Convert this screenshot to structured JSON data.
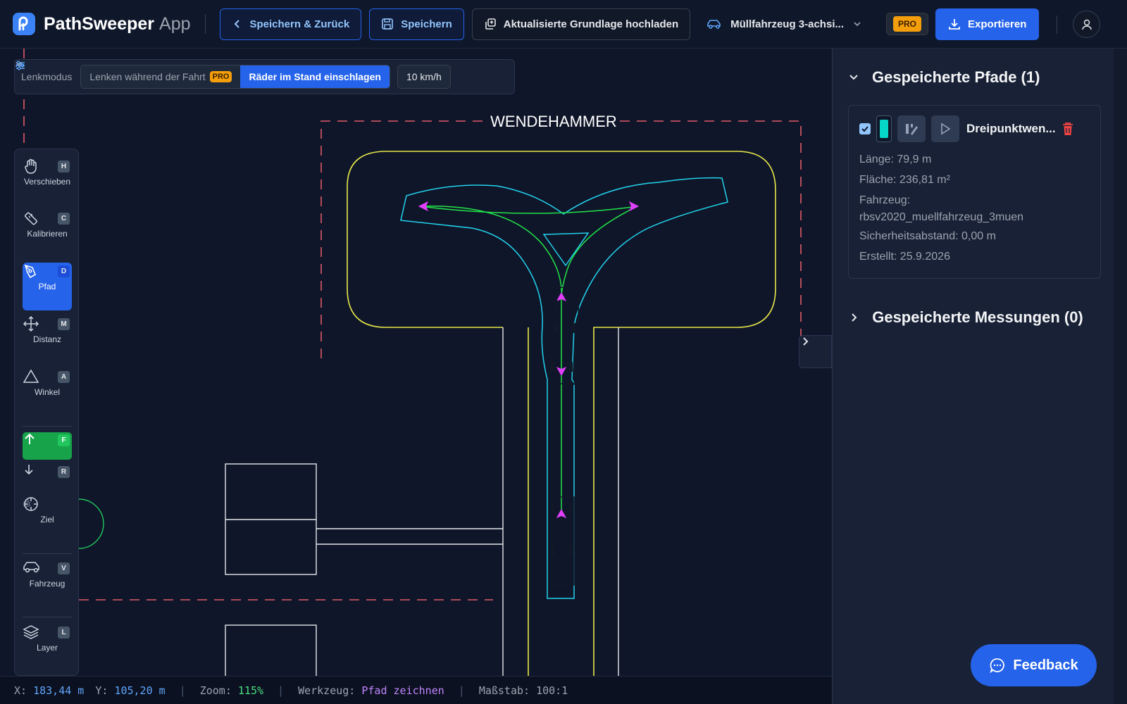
{
  "header": {
    "app_name": "PathSweeper",
    "app_suffix": "App",
    "save_back_label": "Speichern & Zurück",
    "save_label": "Speichern",
    "upload_label": "Aktualisierte Grundlage hochladen",
    "vehicle_label": "Müllfahrzeug 3-achsi...",
    "pro_label": "PRO",
    "export_label": "Exportieren"
  },
  "steering": {
    "label": "Lenkmodus",
    "options": [
      {
        "label": "Lenken während der Fahrt",
        "badge": "PRO",
        "active": false
      },
      {
        "label": "Räder im Stand einschlagen",
        "active": true
      }
    ],
    "speed": "10 km/h"
  },
  "canvas": {
    "area_label": "WENDEHAMMER"
  },
  "tools": [
    {
      "name": "pan",
      "label": "Verschieben",
      "key": "H",
      "icon": "hand-icon"
    },
    {
      "name": "calibrate",
      "label": "Kalibrieren",
      "key": "C",
      "icon": "ruler-icon"
    },
    {
      "name": "path",
      "label": "Pfad",
      "key": "D",
      "icon": "pen-tool-icon",
      "active": true
    },
    {
      "name": "distance",
      "label": "Distanz",
      "key": "M",
      "icon": "move-icon"
    },
    {
      "name": "angle",
      "label": "Winkel",
      "key": "A",
      "icon": "triangle-icon"
    },
    {
      "name": "forward",
      "label": "",
      "key": "F",
      "icon": "arrow-up-icon"
    },
    {
      "name": "reverse",
      "label": "",
      "key": "R",
      "icon": "arrow-down-icon"
    },
    {
      "name": "target",
      "label": "Ziel",
      "key": "",
      "icon": "crosshair-icon"
    },
    {
      "name": "vehicle",
      "label": "Fahrzeug",
      "key": "V",
      "icon": "car-icon"
    },
    {
      "name": "layer",
      "label": "Layer",
      "key": "L",
      "icon": "layers-icon"
    }
  ],
  "status": {
    "x_label": "X:",
    "x_value": "183,44 m",
    "y_label": "Y:",
    "y_value": "105,20 m",
    "zoom_label": "Zoom:",
    "zoom_value": "115%",
    "tool_label": "Werkzeug:",
    "tool_value": "Pfad zeichnen",
    "scale_label": "Maßstab:",
    "scale_value": "100:1"
  },
  "panel": {
    "paths_title": "Gespeicherte Pfade (1)",
    "measurements_title": "Gespeicherte Messungen (0)",
    "path": {
      "name": "Dreipunktwen...",
      "color": "#06d6c7",
      "checked": true,
      "length": "Länge: 79,9 m",
      "area": "Fläche: 236,81 m²",
      "vehicle_label": "Fahrzeug:",
      "vehicle_value": "rbsv2020_muellfahrzeug_3muen",
      "safety": "Sicherheitsabstand: 0,00 m",
      "created": "Erstellt: 25.9.2026"
    }
  },
  "feedback_label": "Feedback"
}
